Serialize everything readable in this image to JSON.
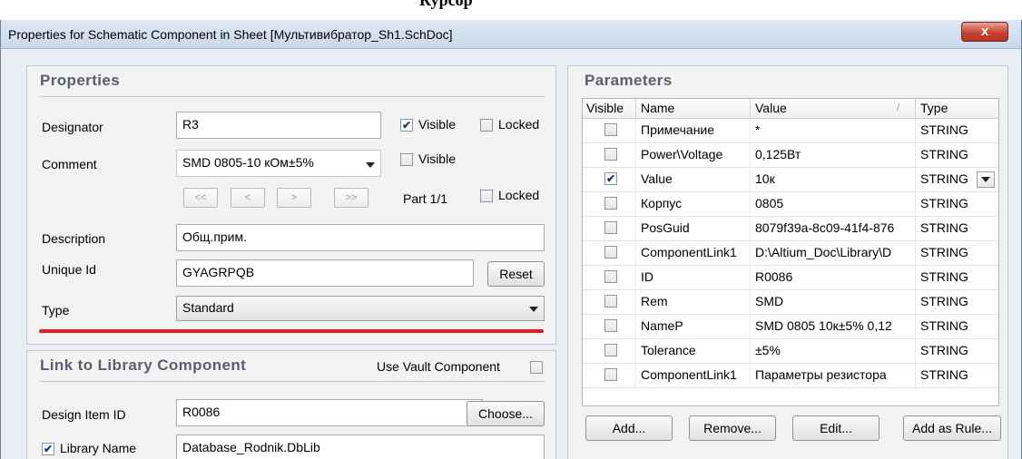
{
  "header_text": "Курсор",
  "window": {
    "title": "Properties for Schematic Component in Sheet [Мультивибратор_Sh1.SchDoc]",
    "close_label": "x"
  },
  "properties": {
    "heading": "Properties",
    "designator": {
      "label": "Designator",
      "value": "R3",
      "visible_label": "Visible",
      "visible": true,
      "locked_label": "Locked",
      "locked": false
    },
    "comment": {
      "label": "Comment",
      "value": "SMD 0805-10 кОм±5%",
      "visible_label": "Visible",
      "visible": false
    },
    "nav": {
      "first": "<<",
      "prev": "<",
      "next": ">",
      "last": ">>",
      "part": "Part 1/1",
      "locked_label": "Locked",
      "locked": false
    },
    "description": {
      "label": "Description",
      "value": "Общ.прим."
    },
    "unique_id": {
      "label": "Unique Id",
      "value": "GYAGRPQB",
      "reset_label": "Reset"
    },
    "type": {
      "label": "Type",
      "value": "Standard"
    }
  },
  "library_link": {
    "heading": "Link to Library Component",
    "use_vault_label": "Use Vault Component",
    "use_vault": false,
    "design_item": {
      "label": "Design Item ID",
      "value": "R0086",
      "choose_label": "Choose..."
    },
    "library_name": {
      "label": "Library Name",
      "checked": true,
      "value": "Database_Rodnik.DbLib"
    }
  },
  "parameters": {
    "heading": "Parameters",
    "columns": {
      "visible": "Visible",
      "name": "Name",
      "value": "Value",
      "sort_mark": "/",
      "type": "Type"
    },
    "rows": [
      {
        "visible": false,
        "name": "Примечание",
        "value": "*",
        "type": "STRING"
      },
      {
        "visible": false,
        "name": "Power\\Voltage",
        "value": "0,125Вт",
        "type": "STRING"
      },
      {
        "visible": true,
        "name": "Value",
        "value": "10к",
        "type": "STRING"
      },
      {
        "visible": false,
        "name": "Корпус",
        "value": "0805",
        "type": "STRING"
      },
      {
        "visible": false,
        "name": "PosGuid",
        "value": "8079f39a-8c09-41f4-876",
        "type": "STRING"
      },
      {
        "visible": false,
        "name": "ComponentLink1",
        "value": "D:\\Altium_Doc\\Library\\D",
        "type": "STRING"
      },
      {
        "visible": false,
        "name": "ID",
        "value": "R0086",
        "type": "STRING"
      },
      {
        "visible": false,
        "name": "Rem",
        "value": "SMD",
        "type": "STRING"
      },
      {
        "visible": false,
        "name": "NameP",
        "value": "SMD 0805 10к±5% 0,12",
        "type": "STRING"
      },
      {
        "visible": false,
        "name": "Tolerance",
        "value": "±5%",
        "type": "STRING"
      },
      {
        "visible": false,
        "name": "ComponentLink1",
        "value": "Параметры резистора",
        "type": "STRING"
      }
    ],
    "buttons": {
      "add": "Add...",
      "remove": "Remove...",
      "edit": "Edit...",
      "add_rule": "Add as Rule..."
    }
  }
}
